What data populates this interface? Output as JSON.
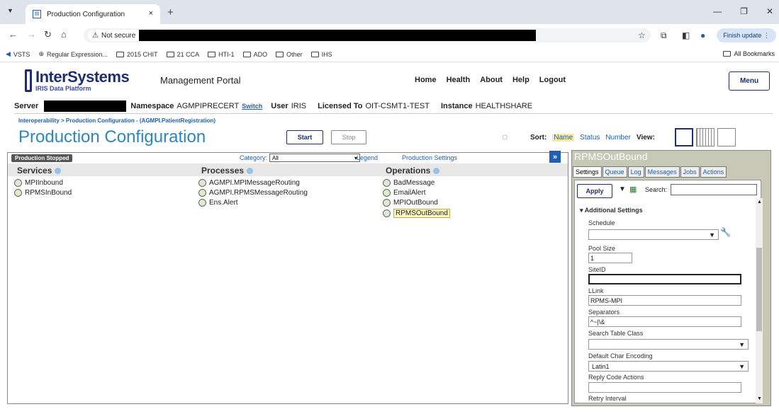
{
  "browser": {
    "tab_title": "Production Configuration",
    "tab_close": "×",
    "new_tab": "+",
    "not_secure": "Not secure",
    "finish_update": "Finish update",
    "bookmarks": [
      "VSTS",
      "Regular Expression...",
      "2015 CHIT",
      "21 CCA",
      "HTI-1",
      "ADO",
      "Other",
      "IHS"
    ],
    "all_bookmarks": "All Bookmarks"
  },
  "header": {
    "logo_text": "InterSystems",
    "logo_sub": "IRIS Data Platform",
    "portal_title": "Management Portal",
    "nav": [
      "Home",
      "Health",
      "About",
      "Help",
      "Logout"
    ],
    "menu_label": "Menu"
  },
  "infobar": {
    "server_label": "Server",
    "namespace_label": "Namespace",
    "namespace_value": "AGMPIPRECERT",
    "switch_label": "Switch",
    "user_label": "User",
    "user_value": "IRIS",
    "licensed_label": "Licensed To",
    "licensed_value": "OIT-CSMT1-TEST",
    "instance_label": "Instance",
    "instance_value": "HEALTHSHARE"
  },
  "breadcrumb": "Interoperability > Production Configuration  - (AGMPI.PatientRegistration)",
  "page_title": "Production Configuration",
  "buttons": {
    "start": "Start",
    "stop": "Stop"
  },
  "sort": {
    "label": "Sort:",
    "options": [
      "Name",
      "Status",
      "Number"
    ],
    "view_label": "View:"
  },
  "diagram": {
    "status": "Production Stopped",
    "category_label": "Category:",
    "category_value": "All",
    "legend": "Legend",
    "production_settings": "Production Settings",
    "columns": {
      "services": "Services",
      "processes": "Processes",
      "operations": "Operations"
    },
    "services": [
      "MPIInbound",
      "RPMSInBound"
    ],
    "processes": [
      "AGMPI.MPIMessageRouting",
      "AGMPI.RPMSMessageRouting",
      "Ens.Alert"
    ],
    "operations": [
      "BadMessage",
      "EmailAlert",
      "MPIOutBound",
      "RPMSOutBound"
    ]
  },
  "panel": {
    "title": "RPMSOutBound",
    "tabs": [
      "Settings",
      "Queue",
      "Log",
      "Messages",
      "Jobs",
      "Actions"
    ],
    "apply": "Apply",
    "search_label": "Search:",
    "section": "Additional Settings",
    "fields": {
      "schedule": {
        "label": "Schedule",
        "value": ""
      },
      "pool_size": {
        "label": "Pool Size",
        "value": "1"
      },
      "site_id": {
        "label": "SiteID",
        "value": ""
      },
      "llink": {
        "label": "LLink",
        "value": "RPMS-MPI"
      },
      "separators": {
        "label": "Separators",
        "value": "^~|\\&"
      },
      "search_table": {
        "label": "Search Table Class",
        "value": ""
      },
      "default_char": {
        "label": "Default Char Encoding",
        "value": "Latin1"
      },
      "reply_code": {
        "label": "Reply Code Actions",
        "value": ""
      },
      "retry": {
        "label": "Retry Interval"
      }
    }
  }
}
